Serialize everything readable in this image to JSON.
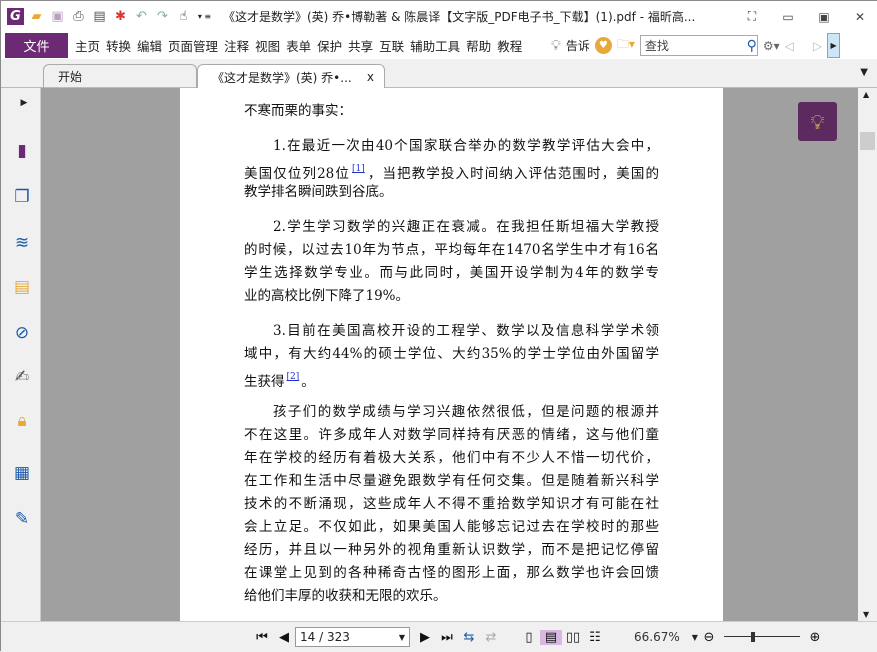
{
  "window": {
    "title": "《这才是数学》(英) 乔•博勒著 & 陈晨译【文字版_PDF电子书_下载】(1).pdf - 福昕高...",
    "app_icon": "G"
  },
  "menu": {
    "file": "文件",
    "items": [
      "主页",
      "转换",
      "编辑",
      "页面管理",
      "注释",
      "视图",
      "表单",
      "保护",
      "共享",
      "互联",
      "辅助工具",
      "帮助",
      "教程"
    ],
    "tell": "告诉",
    "search_placeholder": "查找"
  },
  "tabs": [
    {
      "label": "开始"
    },
    {
      "label": "《这才是数学》(英) 乔•...",
      "close": "x"
    }
  ],
  "document": {
    "paragraphs": [
      {
        "indent": false,
        "lines": [
          "不寒而栗的事实："
        ]
      },
      {
        "indent": true,
        "lines": [
          "1.在最近一次由40个国家联合举办的数学教学评估大会中，",
          "美国仅位列28位[1]，当把教学投入时间纳入评估范围时，美国的",
          "教学排名瞬间跌到谷底。"
        ]
      },
      {
        "indent": true,
        "lines": [
          "2.学生学习数学的兴趣正在衰减。在我担任斯坦福大学教授",
          "的时候，以过去10年为节点，平均每年在1470名学生中才有16名",
          "学生选择数学专业。而与此同时，美国开设学制为4年的数学专",
          "业的高校比例下降了19%。"
        ]
      },
      {
        "indent": true,
        "lines": [
          "3.目前在美国高校开设的工程学、数学以及信息科学学术领",
          "域中，有大约44%的硕士学位、大约35%的学士学位由外国留学",
          "生获得[2]。"
        ]
      },
      {
        "indent": true,
        "lines": [
          "孩子们的数学成绩与学习兴趣依然很低，但是问题的根源并",
          "不在这里。许多成年人对数学同样持有厌恶的情绪，这与他们童",
          "年在学校的经历有着极大关系，他们中有不少人不惜一切代价，",
          "在工作和生活中尽量避免跟数学有任何交集。但是随着新兴科学",
          "技术的不断涌现，这些成年人不得不重拾数学知识才有可能在社",
          "会上立足。不仅如此，如果美国人能够忘记过去在学校时的那些",
          "经历，并且以一种另外的视角重新认识数学，而不是把记忆停留",
          "在课堂上见到的各种稀奇古怪的图形上面，那么数学也许会回馈",
          "给他们丰厚的收获和无限的欢乐。"
        ]
      }
    ]
  },
  "status": {
    "page": "14 / 323",
    "zoom": "66.67%",
    "zoom_fraction": 0.35
  },
  "colors": {
    "accent": "#6d2a74",
    "bulb_bg": "#5c2a5f"
  }
}
